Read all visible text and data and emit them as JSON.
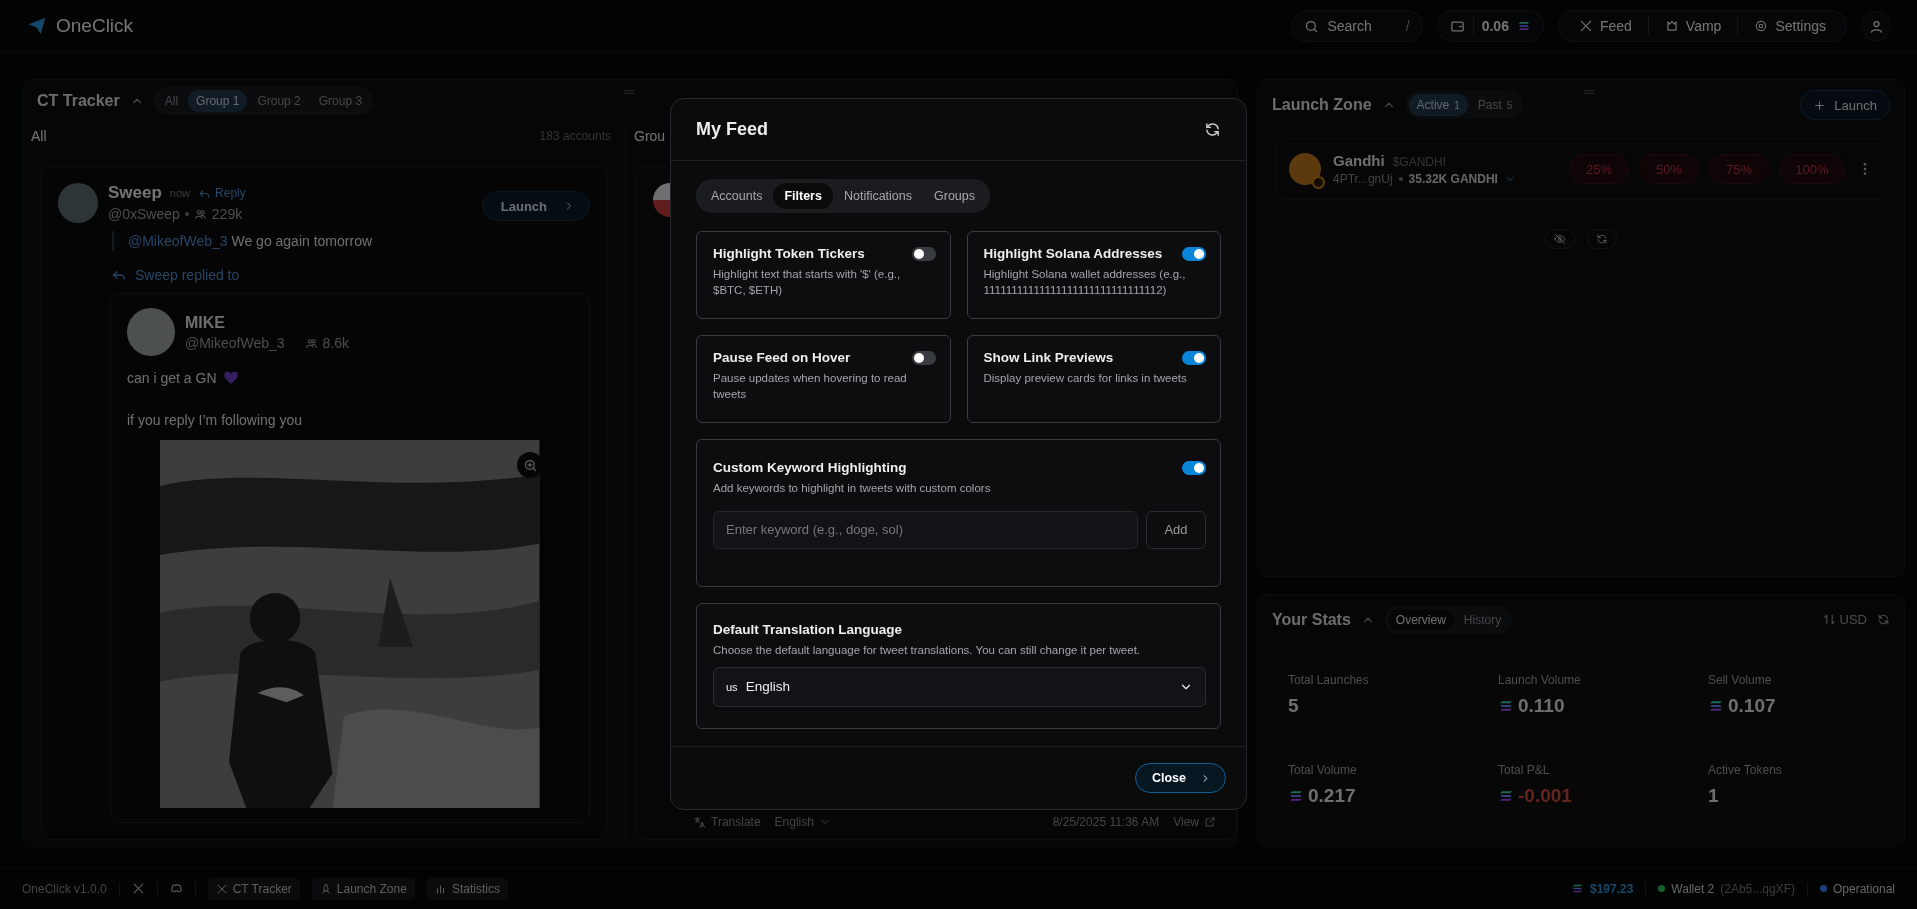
{
  "topbar": {
    "brand": "OneClick",
    "search": {
      "label": "Search",
      "shortcut": "/"
    },
    "balance": "0.06",
    "nav": [
      {
        "kind": "x",
        "label": "Feed"
      },
      {
        "kind": "vamp",
        "label": "Vamp"
      },
      {
        "kind": "settings",
        "label": "Settings"
      }
    ]
  },
  "ct_tracker": {
    "title": "CT Tracker",
    "groups": [
      {
        "label": "All",
        "selected": false
      },
      {
        "label": "Group 1",
        "selected": true
      },
      {
        "label": "Group 2",
        "selected": false
      },
      {
        "label": "Group 3",
        "selected": false
      }
    ],
    "columns": [
      {
        "title": "All",
        "count": "183 accounts"
      },
      {
        "title": "Grou"
      }
    ],
    "tweet": {
      "author": "Sweep",
      "time": "now",
      "reply_label": "Reply",
      "handle": "@0xSweep",
      "followers": "229k",
      "launch": "Launch",
      "mention": "@MikeofWeb_3",
      "text": "We go again tomorrow",
      "replied_to": "Sweep replied to",
      "quoted": {
        "author": "MIKE",
        "handle": "@MikeofWeb_3",
        "followers": "8.6k",
        "lines": [
          "can i get a GN",
          "if you reply I’m following you"
        ],
        "media": {
          "kind": "picture"
        }
      }
    },
    "second_tweet_footer": {
      "translate": "Translate",
      "language": "English",
      "time": "8/25/2025 11:36 AM",
      "view": "View"
    }
  },
  "launch_zone": {
    "title": "Launch Zone",
    "tabs": [
      {
        "label": "Active",
        "count": "1",
        "selected": true
      },
      {
        "label": "Past",
        "count": "5",
        "selected": false
      }
    ],
    "launch": "Launch",
    "token": {
      "name": "Gandhi",
      "ticker": "$GANDHI",
      "address": "4PTr...gnUj",
      "amount": "35.32K GANDHI",
      "sells": [
        "25%",
        "50%",
        "75%",
        "100%"
      ]
    }
  },
  "stats": {
    "title": "Your Stats",
    "tabs": [
      {
        "label": "Overview",
        "selected": true
      },
      {
        "label": "History",
        "selected": false
      }
    ],
    "currency": "USD",
    "cards": [
      {
        "label": "Total Launches",
        "value": "5",
        "kind": "count",
        "negative": false
      },
      {
        "label": "Launch Volume",
        "value": "0.110",
        "kind": "sol",
        "negative": false
      },
      {
        "label": "Sell Volume",
        "value": "0.107",
        "kind": "sol",
        "negative": false
      },
      {
        "label": "Total Volume",
        "value": "0.217",
        "kind": "sol",
        "negative": false
      },
      {
        "label": "Total P&L",
        "value": "-0.001",
        "kind": "sol",
        "negative": true
      },
      {
        "label": "Active Tokens",
        "value": "1",
        "kind": "count",
        "negative": false
      }
    ]
  },
  "footer": {
    "version": "OneClick v1.0.0",
    "links": [
      {
        "kind": "x"
      },
      {
        "kind": "discord"
      }
    ],
    "tabs": [
      {
        "kind": "x",
        "label": "CT Tracker"
      },
      {
        "kind": "rocket",
        "label": "Launch Zone"
      },
      {
        "kind": "chart",
        "label": "Statistics"
      }
    ],
    "balance": "$197.23",
    "wallet": {
      "label": "Wallet 2",
      "address": "(2Ab5...qgXF)"
    },
    "status": {
      "label": "Operational"
    }
  },
  "modal": {
    "title": "My Feed",
    "tabs": [
      {
        "label": "Accounts",
        "selected": false
      },
      {
        "label": "Filters",
        "selected": true
      },
      {
        "label": "Notifications",
        "selected": false
      },
      {
        "label": "Groups",
        "selected": false
      }
    ],
    "toggles": [
      {
        "title": "Highlight Token Tickers",
        "description": "Highlight text that starts with '$' (e.g., $BTC, $ETH)",
        "on": false
      },
      {
        "title": "Highlight Solana Addresses",
        "description": "Highlight Solana wallet addresses (e.g., 11111111111111111111111111111112)",
        "on": true
      },
      {
        "title": "Pause Feed on Hover",
        "description": "Pause updates when hovering to read tweets",
        "on": false
      },
      {
        "title": "Show Link Previews",
        "description": "Display preview cards for links in tweets",
        "on": true
      }
    ],
    "keyword": {
      "title": "Custom Keyword Highlighting",
      "description": "Add keywords to highlight in tweets with custom colors",
      "on": true,
      "placeholder": "Enter keyword (e.g., doge, sol)",
      "add": "Add"
    },
    "language": {
      "title": "Default Translation Language",
      "description": "Choose the default language for tweet translations. You can still change it per tweet.",
      "flag": "us",
      "value": "English"
    },
    "close": "Close"
  }
}
